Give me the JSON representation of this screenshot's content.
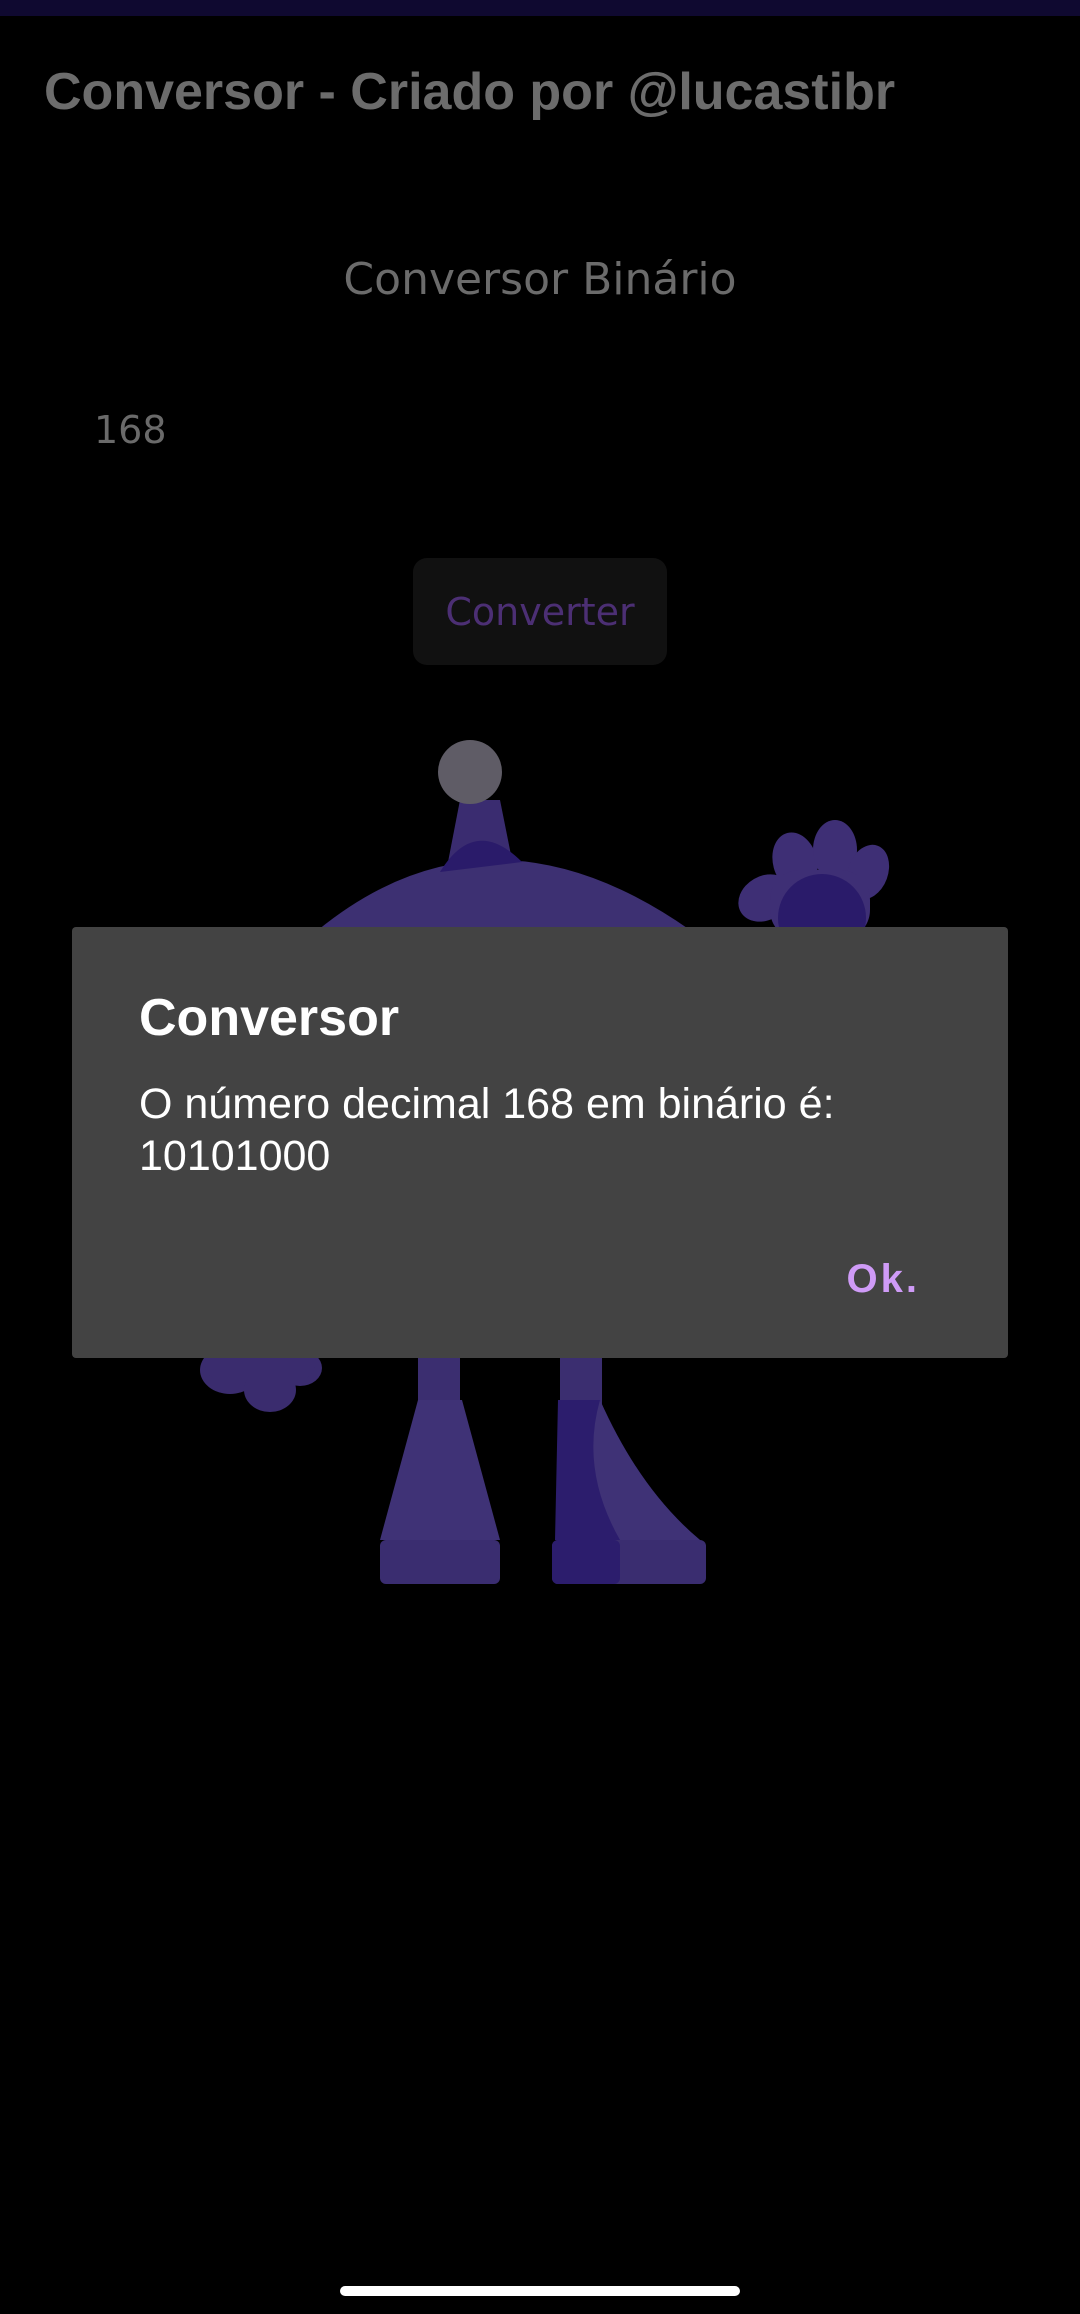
{
  "app_bar": {
    "title": "Conversor - Criado por @lucastibr"
  },
  "main": {
    "heading": "Conversor Binário",
    "input_value": "168",
    "convert_button_label": "Converter"
  },
  "dialog": {
    "title": "Conversor",
    "message": "O número decimal 168 em binário é: 10101000",
    "ok_label": "Ok."
  },
  "colors": {
    "accent": "#cf9bf7",
    "dialog_background": "#434343",
    "mascot": "#3d2f73"
  }
}
